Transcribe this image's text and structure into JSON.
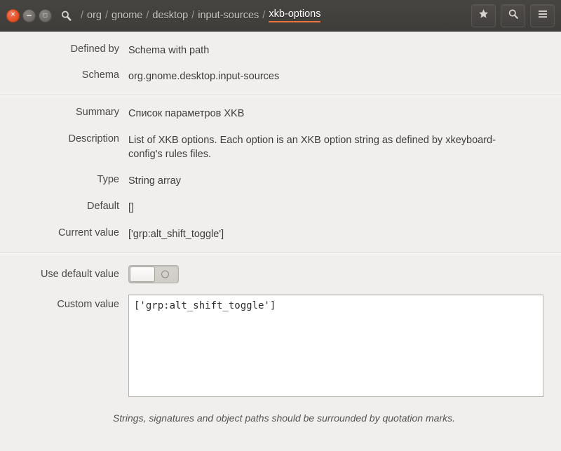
{
  "titlebar": {
    "window_controls": {
      "close_label": "×",
      "minimize_label": "−",
      "maximize_label": "□"
    },
    "path_icon": "search-path-icon",
    "separator": "/",
    "breadcrumb": [
      "org",
      "gnome",
      "desktop",
      "input-sources"
    ],
    "breadcrumb_active": "xkb-options",
    "buttons": [
      {
        "name": "bookmark-button",
        "icon": "star-icon"
      },
      {
        "name": "search-button",
        "icon": "search-icon"
      },
      {
        "name": "menu-button",
        "icon": "hamburger-icon"
      }
    ],
    "accent_color": "#e8743b",
    "background_color": "#423f3c"
  },
  "info": {
    "defined_by_label": "Defined by",
    "defined_by_value": "Schema with path",
    "schema_label": "Schema",
    "schema_value": "org.gnome.desktop.input-sources"
  },
  "details": {
    "summary_label": "Summary",
    "summary_value": "Список параметров XKB",
    "description_label": "Description",
    "description_value": "List of XKB options. Each option is an XKB option string as defined by xkeyboard-config's rules files.",
    "type_label": "Type",
    "type_value": "String array",
    "default_label": "Default",
    "default_value": "[]",
    "current_value_label": "Current value",
    "current_value_value": "['grp:alt_shift_toggle']"
  },
  "editor": {
    "use_default_label": "Use default value",
    "use_default_state": "off",
    "custom_value_label": "Custom value",
    "custom_value_text": "['grp:alt_shift_toggle']",
    "hint": "Strings, signatures and object paths should be surrounded by quotation marks."
  }
}
